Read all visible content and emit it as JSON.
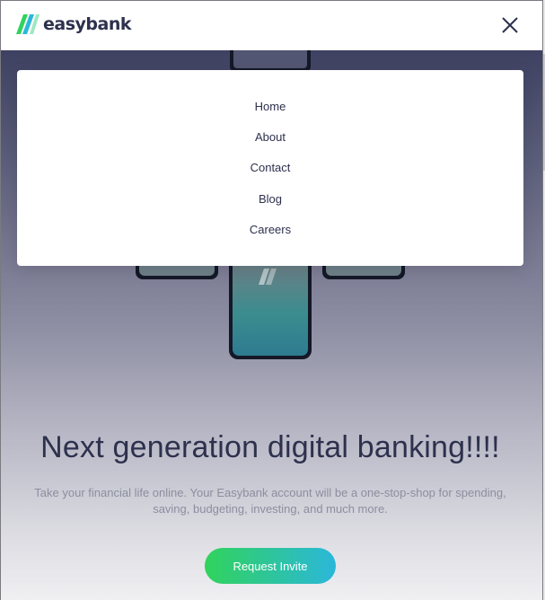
{
  "header": {
    "logo_text": "easybank",
    "close_icon": "close-icon"
  },
  "menu": {
    "items": [
      {
        "label": "Home"
      },
      {
        "label": "About"
      },
      {
        "label": "Contact"
      },
      {
        "label": "Blog"
      },
      {
        "label": "Careers"
      }
    ]
  },
  "hero": {
    "headline": "Next generation digital banking!!!!",
    "subtext": "Take your financial life online. Your Easybank account will be a one-stop-shop for spending, saving, budgeting, investing, and much more.",
    "cta_label": "Request Invite"
  },
  "colors": {
    "brand_dark": "#2d314d",
    "brand_green": "#31d35c",
    "brand_cyan": "#2bb7da",
    "text_muted": "#8b8e9e"
  }
}
